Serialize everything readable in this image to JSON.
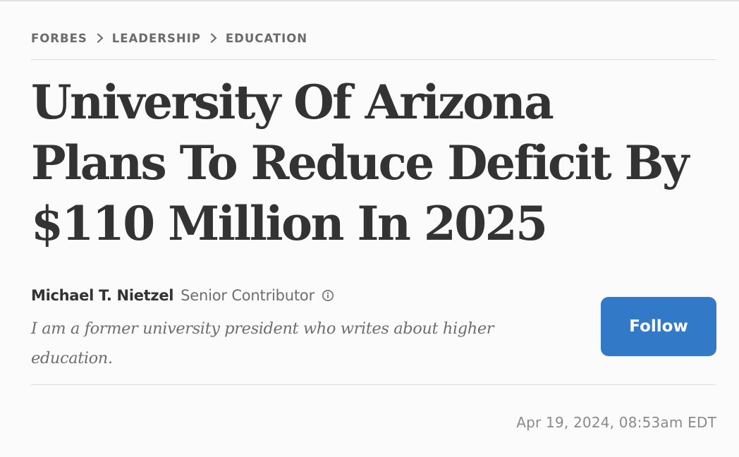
{
  "breadcrumb": {
    "items": [
      "FORBES",
      "LEADERSHIP",
      "EDUCATION"
    ],
    "separator_icon": "chevron-right-icon"
  },
  "headline": {
    "lines": [
      "University Of Arizona",
      "Plans To Reduce Deficit By",
      "$110 Million In 2025"
    ]
  },
  "author": {
    "name": "Michael T. Nietzel",
    "role": "Senior Contributor",
    "info_icon": "info-circle-icon",
    "bio": "I am a former university president who writes about higher education."
  },
  "follow": {
    "label": "Follow",
    "color": "#327ac7"
  },
  "published": "Apr 19, 2024, 08:53am EDT"
}
